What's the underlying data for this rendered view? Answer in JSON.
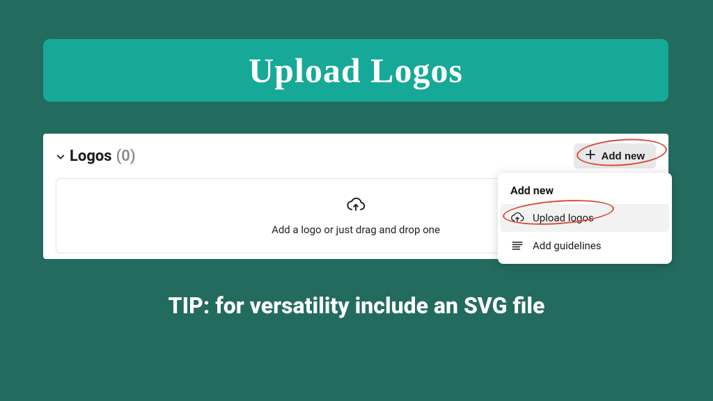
{
  "banner": {
    "title": "Upload Logos"
  },
  "panel": {
    "section_title": "Logos",
    "count_display": "(0)",
    "add_new_label": "Add new",
    "dropzone_text": "Add a logo or just drag and drop one"
  },
  "menu": {
    "title": "Add new",
    "items": [
      {
        "label": "Upload logos"
      },
      {
        "label": "Add guidelines"
      }
    ]
  },
  "tip": {
    "text": "TIP: for versatility include an SVG file"
  }
}
